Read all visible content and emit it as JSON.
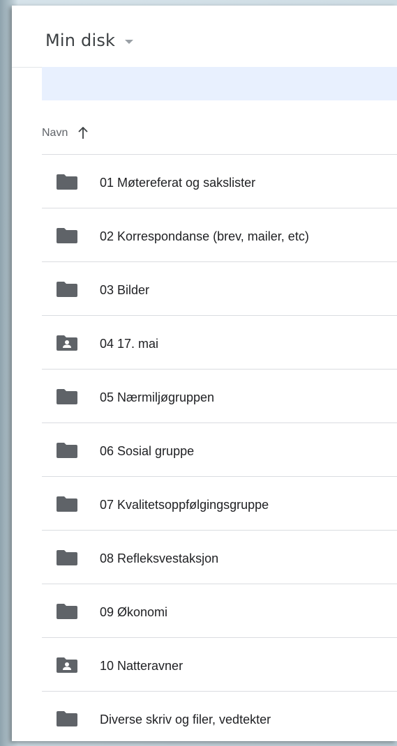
{
  "header": {
    "title": "Min disk"
  },
  "list_header": {
    "sort_label": "Navn",
    "sort_direction": "ascending"
  },
  "colors": {
    "folder": "#5f6368",
    "banner": "#e8f0fe",
    "divider": "#dadce0"
  },
  "files": [
    {
      "name": "01 Møtereferat og sakslister",
      "icon": "folder-icon"
    },
    {
      "name": "02 Korrespondanse (brev, mailer, etc)",
      "icon": "folder-icon"
    },
    {
      "name": "03 Bilder",
      "icon": "folder-icon"
    },
    {
      "name": "04 17. mai",
      "icon": "shared-folder-icon"
    },
    {
      "name": "05 Nærmiljøgruppen",
      "icon": "folder-icon"
    },
    {
      "name": "06 Sosial gruppe",
      "icon": "folder-icon"
    },
    {
      "name": "07 Kvalitetsoppfølgingsgruppe",
      "icon": "folder-icon"
    },
    {
      "name": "08 Refleksvestaksjon",
      "icon": "folder-icon"
    },
    {
      "name": "09 Økonomi",
      "icon": "folder-icon"
    },
    {
      "name": "10 Natteravner",
      "icon": "shared-folder-icon"
    },
    {
      "name": "Diverse skriv og filer, vedtekter",
      "icon": "folder-icon"
    }
  ]
}
